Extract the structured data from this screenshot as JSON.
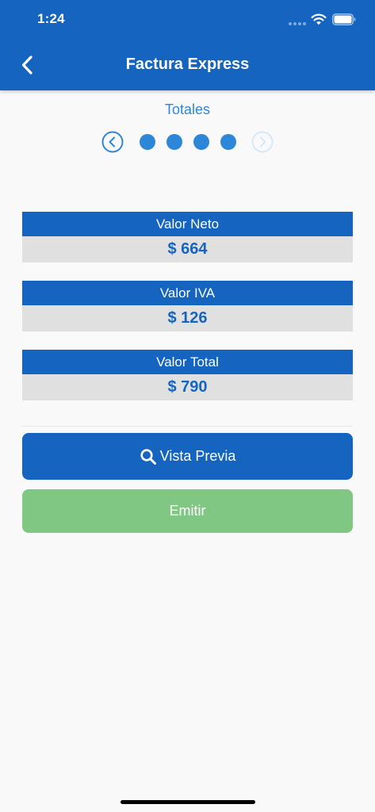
{
  "status_bar": {
    "time": "1:24"
  },
  "header": {
    "title": "Factura Express",
    "back_icon": "chevron-left-icon"
  },
  "step": {
    "title": "Totales",
    "prev_icon": "circle-chevron-left-icon",
    "next_icon": "circle-chevron-right-icon",
    "dot_count": 4,
    "next_enabled": false
  },
  "totals": [
    {
      "label": "Valor Neto",
      "value": "$ 664"
    },
    {
      "label": "Valor IVA",
      "value": "$ 126"
    },
    {
      "label": "Valor Total",
      "value": "$ 790"
    }
  ],
  "actions": {
    "preview_label": "Vista Previa",
    "preview_icon": "search-icon",
    "emit_label": "Emitir"
  },
  "colors": {
    "primary": "#1565c0",
    "accent": "#2e86d6",
    "value_bg": "#e0e0e0",
    "emit": "#81c784",
    "background": "#f9f9f9"
  }
}
